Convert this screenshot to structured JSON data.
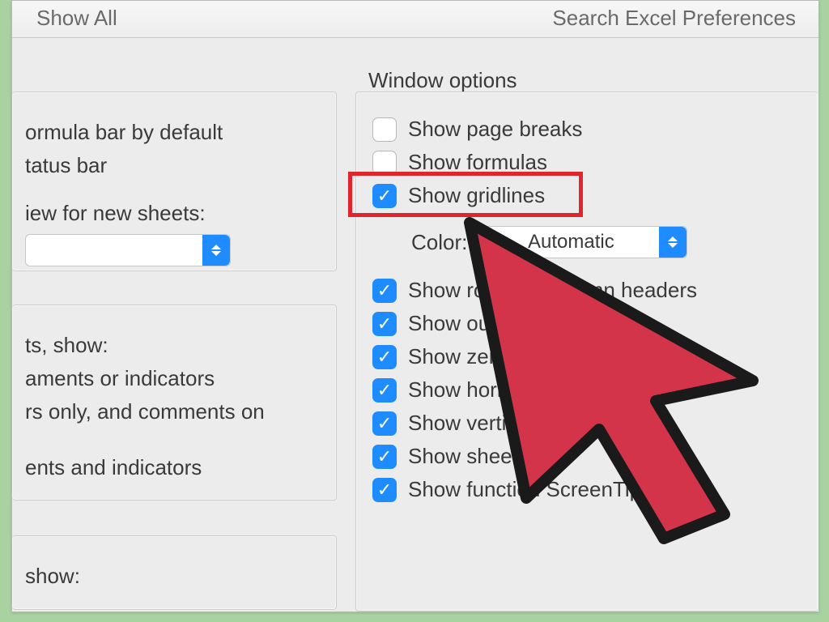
{
  "toolbar": {
    "back_label": "Show All",
    "search_label": "Search Excel Preferences"
  },
  "section_title": "Window options",
  "left": {
    "formula_bar": "ormula bar by default",
    "status_bar": "tatus bar",
    "default_view_label": "iew for new sheets:",
    "default_view_value": "",
    "comments_show": "ts, show:",
    "opt1": "aments or indicators",
    "opt2": "rs only, and comments on",
    "opt3": "ents and indicators",
    "objects_show": "show:"
  },
  "right": {
    "page_breaks": "Show page breaks",
    "formulas": "Show formulas",
    "gridlines": "Show gridlines",
    "color_label": "Color:",
    "color_value": "Automatic",
    "row_headers": "Show row and column headers",
    "outline": "Show outline symbols",
    "zero": "Show zero values",
    "hscroll": "Show horizontal scroll bar",
    "vscroll": "Show vertical scroll bar",
    "tabs": "Show sheet tabs",
    "screentips": "Show function ScreenTips"
  },
  "checked": {
    "page_breaks": false,
    "formulas": false,
    "gridlines": true,
    "row_headers": true,
    "outline": true,
    "zero": true,
    "hscroll": true,
    "vscroll": true,
    "tabs": true,
    "screentips": true
  }
}
